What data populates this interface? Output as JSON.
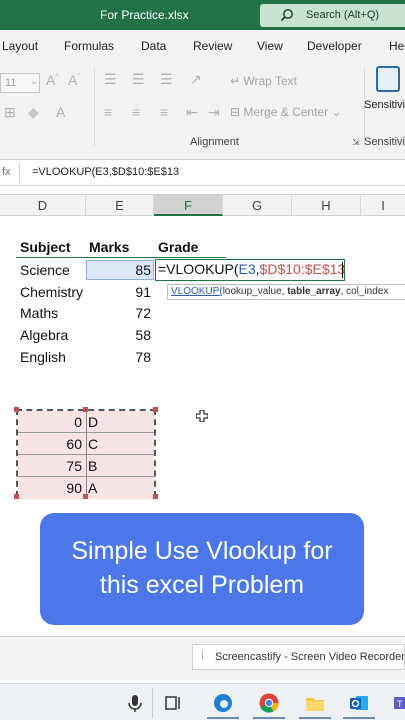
{
  "window": {
    "title": "For Practice.xlsx",
    "search_label": "Search (Alt+Q)"
  },
  "ribbon": {
    "tabs": [
      "Layout",
      "Formulas",
      "Data",
      "Review",
      "View",
      "Developer",
      "He"
    ],
    "font_size": "11",
    "wrap_text": "Wrap Text",
    "merge_center": "Merge & Center",
    "alignment_label": "Alignment",
    "sensitivity_top": "Sensitivi",
    "sensitivity_bottom": "Sensitivi"
  },
  "formula_bar": {
    "formula": "=VLOOKUP(E3,$D$10:$E$13"
  },
  "columns": [
    "D",
    "E",
    "F",
    "G",
    "H",
    "I"
  ],
  "active_column": "F",
  "headers": {
    "subject": "Subject",
    "marks": "Marks",
    "grade": "Grade"
  },
  "students": [
    {
      "subject": "Science",
      "marks": "85"
    },
    {
      "subject": "Chemistry",
      "marks": "91"
    },
    {
      "subject": "Maths",
      "marks": "72"
    },
    {
      "subject": "Algebra",
      "marks": "58"
    },
    {
      "subject": "English",
      "marks": "78"
    }
  ],
  "edit_cell": {
    "prefix": "=VLOOKUP(",
    "ref1": "E3",
    "comma": ",",
    "ref2": "$D$10:$E$13"
  },
  "tooltip": {
    "fn": "VLOOKUP(",
    "arg1": "lookup_value, ",
    "arg2": "table_array",
    "rest": ", col_index"
  },
  "lookup_table": [
    {
      "value": "0",
      "grade": "D"
    },
    {
      "value": "60",
      "grade": "C"
    },
    {
      "value": "75",
      "grade": "B"
    },
    {
      "value": "90",
      "grade": "A"
    }
  ],
  "banner": {
    "line1": "Simple Use Vlookup for",
    "line2": "this excel Problem"
  },
  "notification": "Screencastify - Screen Video Recorder",
  "taskbar_icons": [
    "microphone-icon",
    "task-view-icon",
    "edge-icon",
    "chrome-icon",
    "file-explorer-icon",
    "outlook-icon",
    "teams-icon"
  ],
  "colors": {
    "excel_green": "#217346",
    "banner_blue": "#4b77e8",
    "ref_blue": "#2d5fb8",
    "ref_red": "#c0504d"
  }
}
